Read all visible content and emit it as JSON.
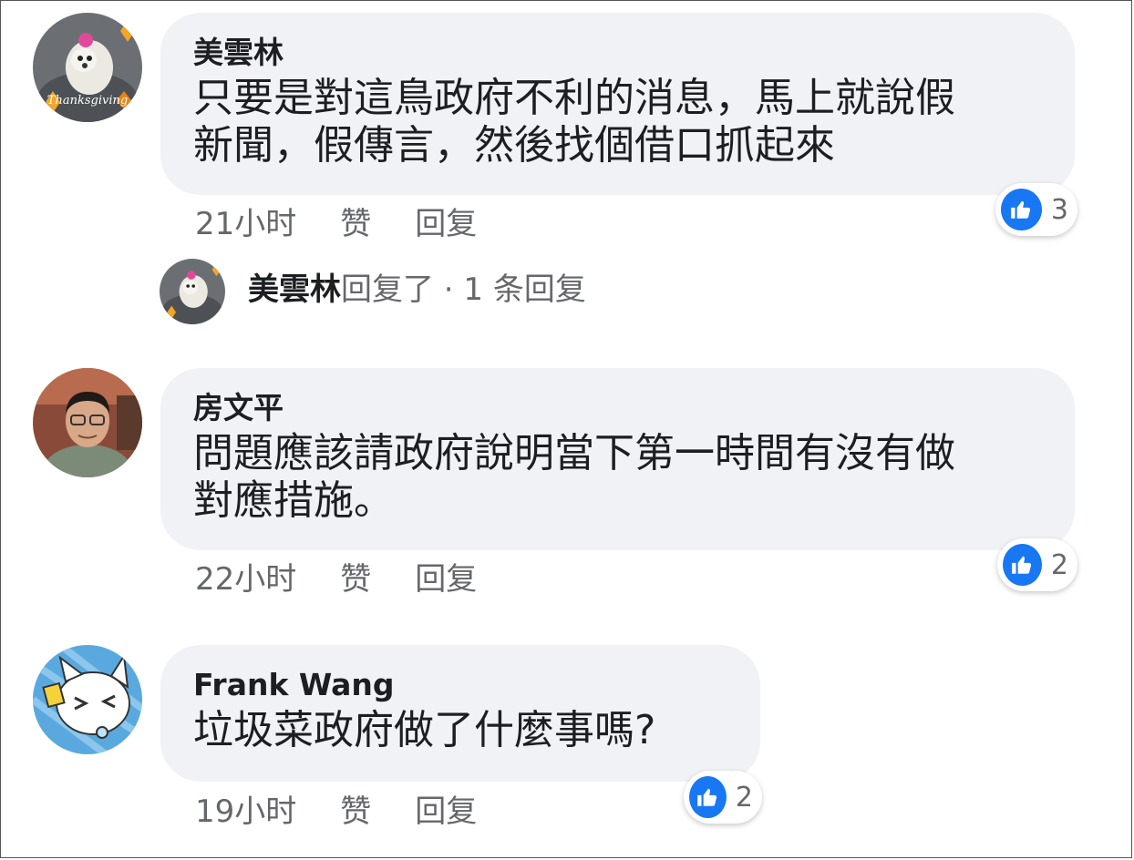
{
  "comments": [
    {
      "author": "美雲林",
      "text": "只要是對這鳥政府不利的消息，馬上就說假\n新聞，假傳言，然後找個借口抓起來",
      "time": "21小时",
      "like_label": "赞",
      "reply_label": "回复",
      "likes": "3",
      "avatar_overlay": "Thanksgiving"
    },
    {
      "author": "房文平",
      "text": "問題應該請政府說明當下第一時間有沒有做\n對應措施。",
      "time": "22小时",
      "like_label": "赞",
      "reply_label": "回复",
      "likes": "2"
    },
    {
      "author": "Frank Wang",
      "text": "垃圾菜政府做了什麼事嗎?",
      "time": "19小时",
      "like_label": "赞",
      "reply_label": "回复",
      "likes": "2"
    }
  ],
  "reply_summary": {
    "author": "美雲林",
    "text": "回复了 · 1 条回复"
  },
  "colors": {
    "bubble": "#f0f2f5",
    "like_blue": "#1877f2",
    "meta_gray": "#65676b"
  }
}
